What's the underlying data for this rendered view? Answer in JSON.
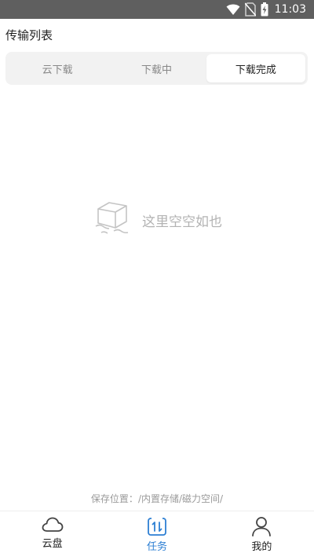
{
  "status_bar": {
    "time": "11:03",
    "icons": [
      "wifi-icon",
      "no-sim-icon",
      "battery-charging-icon"
    ]
  },
  "header": {
    "title": "传输列表"
  },
  "tabs": [
    {
      "label": "云下载",
      "active": false
    },
    {
      "label": "下载中",
      "active": false
    },
    {
      "label": "下载完成",
      "active": true
    }
  ],
  "empty_state": {
    "icon": "empty-box-icon",
    "text": "这里空空如也"
  },
  "save_location": {
    "label": "保存位置：",
    "path": "/内置存储/磁力空间/"
  },
  "bottom_nav": [
    {
      "label": "云盘",
      "icon": "cloud-icon",
      "active": false
    },
    {
      "label": "任务",
      "icon": "transfer-icon",
      "active": true
    },
    {
      "label": "我的",
      "icon": "user-icon",
      "active": false
    }
  ],
  "colors": {
    "status_bar_bg": "#5f5f5f",
    "accent": "#2d7fd3",
    "tab_track": "#f2f2f2",
    "muted_text": "#b3b3b3"
  }
}
